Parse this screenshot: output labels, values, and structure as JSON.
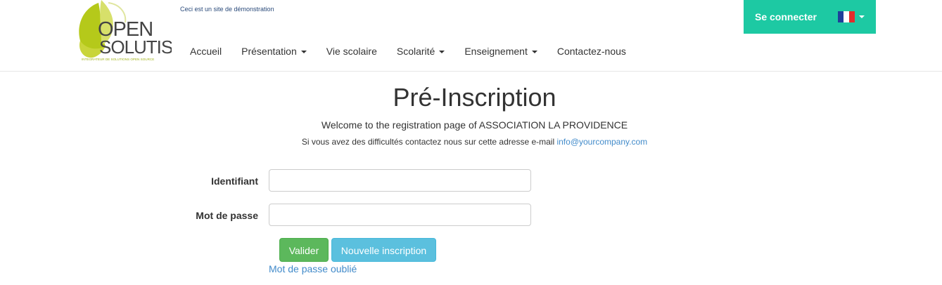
{
  "header": {
    "demo_note": "Ceci est un site de démonstration",
    "logo": {
      "line1": "OPEN",
      "line2": "SOLUTIS",
      "tagline": "INTEGRATEUR DE SOLUTIONS OPEN SOURCE"
    },
    "nav": [
      {
        "label": "Accueil",
        "dropdown": false
      },
      {
        "label": "Présentation",
        "dropdown": true
      },
      {
        "label": "Vie scolaire",
        "dropdown": false
      },
      {
        "label": "Scolarité",
        "dropdown": true
      },
      {
        "label": "Enseignement",
        "dropdown": true
      },
      {
        "label": "Contactez-nous",
        "dropdown": false
      }
    ],
    "login_label": "Se connecter",
    "language_icon": "flag-fr-icon"
  },
  "main": {
    "title": "Pré-Inscription",
    "welcome": "Welcome to the registration page of ASSOCIATION LA PROVIDENCE",
    "contact_text": "Si vous avez des difficultés contactez nous sur cette adresse e-mail",
    "contact_email": "info@yourcompany.com",
    "form": {
      "identifiant_label": "Identifiant",
      "identifiant_value": "",
      "password_label": "Mot de passe",
      "password_value": ""
    },
    "buttons": {
      "validate": "Valider",
      "new_registration": "Nouvelle inscription"
    },
    "forgot_password": "Mot de passe oublié"
  },
  "colors": {
    "accent": "#1dc9a3",
    "link": "#428bca",
    "success": "#5cb85c",
    "info": "#5bc0de",
    "logo_green": "#b5c91a"
  }
}
